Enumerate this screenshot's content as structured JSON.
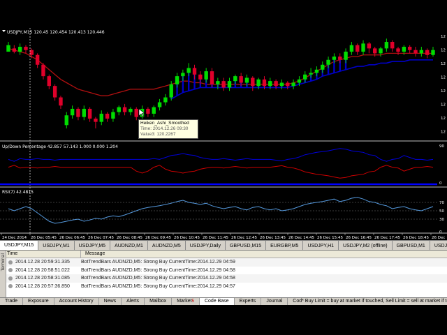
{
  "chart_window": {
    "symbol_header": "USDJPY,M15  120.45 120.454 120.413 120.446",
    "colors": {
      "bull": "#00dd00",
      "bear": "#e0002a",
      "ma_red": "#b01010",
      "ma_blue": "#0000c8",
      "up_line": "#0000dd",
      "down_line": "#cc0000",
      "rsi_line": "#5599dd",
      "grid": "#303030"
    }
  },
  "price_axis": {
    "labels": [
      "12",
      "12",
      "12",
      "12",
      "12",
      "12",
      "12",
      "12"
    ]
  },
  "updown_panel": {
    "label": "Up/Down Percentage 42.857 57.143 1.000 0.000 1.204",
    "axis_top": "90",
    "axis_bottom": "0"
  },
  "rsi_panel": {
    "label": "RSI(7) 42.4815",
    "levels": [
      "70",
      "50",
      "30",
      "0"
    ]
  },
  "time_axis": [
    "24 Dec 2014",
    "26 Dec 05:45",
    "26 Dec 06:45",
    "26 Dec 07:45",
    "26 Dec 08:45",
    "26 Dec 09:45",
    "26 Dec 10:45",
    "26 Dec 11:45",
    "26 Dec 12:45",
    "26 Dec 13:45",
    "26 Dec 14:45",
    "26 Dec 15:45",
    "26 Dec 16:45",
    "26 Dec 17:45",
    "26 Dec 18:45",
    "26 Dec"
  ],
  "tooltip": {
    "line1": "Heiken_Ashi_Smoothed",
    "line2": "Time: 2014.12.26 09:30",
    "line3": "Value3: 120.2267"
  },
  "chart_tabs": [
    "USDJPY,M15",
    "USDJPY,M1",
    "USDJPY,M5",
    "AUDNZD,M1",
    "AUDNZD,M5",
    "USDJPY,Daily",
    "GBPUSD,M15",
    "EURGBP,M5",
    "USDJPY,H1",
    "USDJPY,M2 (offline)",
    "GBPUSD,M1",
    "USDJPY,M"
  ],
  "terminal": {
    "side_label": "Terminal",
    "col_time": "Time",
    "col_message": "Message",
    "rows": [
      {
        "time": "2014.12.28 20:59:31.335",
        "message": "BotTrendBars AUDNZD,M5: Strong Buy CurrentTime:2014.12.29 04:59"
      },
      {
        "time": "2014.12.28 20:58:51.022",
        "message": "BotTrendBars AUDNZD,M5: Strong Buy CurrentTime:2014.12.29 04:58"
      },
      {
        "time": "2014.12.28 20:58:31.085",
        "message": "BotTrendBars AUDNZD,M5: Strong Buy CurrentTime:2014.12.29 04:58"
      },
      {
        "time": "2014.12.28 20:57:36.850",
        "message": "BotTrendBars AUDNZD,M5: Strong Buy CurrentTime:2014.12.29 04:57"
      }
    ]
  },
  "bottom_tabs": [
    "Trade",
    "Exposure",
    "Account History",
    "News",
    "Alerts",
    "Mailbox",
    "Market",
    "Code Base",
    "Experts",
    "Journal"
  ],
  "market_badge": "5",
  "status_hint": "Cod* Buy Limit = buy at market if touched, Sell Limit = sell at market if touched",
  "candles": [
    [
      120.43,
      120.47,
      120.45,
      120.49
    ],
    [
      120.45,
      120.43,
      120.42,
      120.47
    ],
    [
      120.43,
      120.46,
      120.41,
      120.48
    ],
    [
      120.46,
      120.44,
      120.42,
      120.47
    ],
    [
      120.44,
      120.41,
      120.39,
      120.45
    ],
    [
      120.41,
      120.35,
      120.33,
      120.42
    ],
    [
      120.35,
      120.28,
      120.26,
      120.36
    ],
    [
      120.28,
      120.22,
      120.2,
      120.29
    ],
    [
      120.22,
      120.15,
      120.13,
      120.23
    ],
    [
      120.15,
      120.1,
      120.08,
      120.16
    ],
    [
      119.98,
      120.04,
      119.96,
      120.06
    ],
    [
      120.04,
      120.08,
      120.02,
      120.1
    ],
    [
      120.08,
      120.03,
      120.01,
      120.09
    ],
    [
      120.03,
      120.08,
      120.01,
      120.1
    ],
    [
      120.08,
      120.02,
      120.0,
      120.09
    ],
    [
      120.02,
      120.0,
      119.96,
      120.03
    ],
    [
      120.0,
      120.05,
      119.98,
      120.07
    ],
    [
      120.05,
      120.02,
      120.0,
      120.06
    ],
    [
      120.02,
      120.06,
      120.0,
      120.08
    ],
    [
      120.06,
      120.09,
      120.04,
      120.1
    ],
    [
      120.09,
      120.06,
      120.04,
      120.11
    ],
    [
      120.06,
      120.08,
      120.04,
      120.09
    ],
    [
      120.08,
      120.03,
      120.01,
      120.09
    ],
    [
      120.03,
      120.08,
      120.02,
      120.1
    ],
    [
      120.08,
      120.05,
      120.03,
      120.09
    ],
    [
      120.05,
      120.09,
      120.03,
      120.1
    ],
    [
      120.09,
      120.12,
      120.07,
      120.14
    ],
    [
      120.12,
      120.15,
      120.1,
      120.17
    ],
    [
      120.15,
      120.23,
      120.13,
      120.25
    ],
    [
      120.23,
      120.28,
      120.21,
      120.3
    ],
    [
      120.28,
      120.3,
      120.25,
      120.32
    ],
    [
      120.3,
      120.33,
      120.28,
      120.36
    ],
    [
      120.33,
      120.29,
      120.26,
      120.35
    ],
    [
      120.29,
      120.26,
      120.23,
      120.31
    ],
    [
      120.26,
      120.31,
      120.24,
      120.33
    ],
    [
      120.31,
      120.23,
      120.21,
      120.33
    ],
    [
      120.23,
      120.25,
      120.2,
      120.27
    ],
    [
      120.25,
      120.21,
      120.19,
      120.27
    ],
    [
      120.21,
      120.25,
      120.19,
      120.27
    ],
    [
      120.25,
      120.28,
      120.23,
      120.29
    ],
    [
      120.28,
      120.24,
      120.22,
      120.3
    ],
    [
      120.24,
      120.27,
      120.22,
      120.29
    ],
    [
      120.27,
      120.22,
      120.19,
      120.28
    ],
    [
      120.22,
      120.26,
      120.2,
      120.27
    ],
    [
      120.26,
      120.22,
      120.2,
      120.28
    ],
    [
      120.22,
      120.25,
      120.2,
      120.27
    ],
    [
      120.25,
      120.22,
      120.2,
      120.26
    ],
    [
      120.22,
      120.24,
      120.2,
      120.26
    ],
    [
      120.24,
      120.22,
      120.2,
      120.25
    ],
    [
      120.22,
      120.24,
      120.2,
      120.26
    ],
    [
      120.24,
      120.26,
      120.22,
      120.28
    ],
    [
      120.26,
      120.29,
      120.24,
      120.31
    ],
    [
      120.29,
      120.3,
      120.27,
      120.33
    ],
    [
      120.3,
      120.32,
      120.28,
      120.34
    ],
    [
      120.32,
      120.35,
      120.3,
      120.37
    ],
    [
      120.35,
      120.38,
      120.33,
      120.4
    ],
    [
      120.38,
      120.4,
      120.36,
      120.42
    ],
    [
      120.4,
      120.38,
      120.36,
      120.42
    ],
    [
      120.38,
      120.43,
      120.36,
      120.45
    ],
    [
      120.43,
      120.47,
      120.41,
      120.49
    ],
    [
      120.47,
      120.43,
      120.41,
      120.48
    ],
    [
      120.43,
      120.48,
      120.41,
      120.5
    ],
    [
      120.48,
      120.45,
      120.42,
      120.49
    ],
    [
      120.45,
      120.42,
      120.4,
      120.46
    ],
    [
      120.42,
      120.45,
      120.4,
      120.46
    ],
    [
      120.45,
      120.49,
      120.43,
      120.51
    ],
    [
      120.49,
      120.45,
      120.43,
      120.5
    ],
    [
      120.45,
      120.43,
      120.41,
      120.46
    ],
    [
      120.43,
      120.46,
      120.41,
      120.47
    ],
    [
      120.46,
      120.44,
      120.42,
      120.47
    ],
    [
      120.44,
      120.42,
      120.4,
      120.46
    ],
    [
      120.42,
      120.44,
      120.4,
      120.46
    ],
    [
      120.44,
      120.41,
      120.39,
      120.45
    ],
    [
      120.41,
      120.44,
      120.4,
      120.46
    ]
  ],
  "ma_red": [
    120.45,
    120.44,
    120.43,
    120.42,
    120.4,
    120.38,
    120.35,
    120.32,
    120.29,
    120.26,
    120.24,
    120.22,
    120.2,
    120.19,
    120.18,
    120.17,
    120.16,
    120.16,
    120.17,
    120.18,
    120.19,
    120.2,
    120.2,
    120.2,
    120.2,
    120.2,
    120.21,
    120.22,
    120.23,
    120.24,
    120.25,
    120.25,
    120.24,
    120.24,
    120.23,
    120.23,
    120.23,
    120.23,
    120.23,
    120.23,
    120.23,
    120.23,
    120.23,
    120.23,
    120.23,
    120.23,
    120.23,
    120.23,
    120.23,
    120.24,
    120.25,
    120.27,
    120.29,
    120.31,
    120.33,
    120.35,
    120.37,
    120.38,
    120.39,
    120.4,
    120.4,
    120.41,
    120.41,
    120.41,
    120.41,
    120.42,
    120.42,
    120.42,
    120.42,
    120.42,
    120.42,
    120.42,
    120.42,
    120.42
  ],
  "ma_blue": [
    null,
    null,
    null,
    null,
    null,
    null,
    null,
    null,
    null,
    null,
    null,
    null,
    null,
    null,
    null,
    null,
    null,
    null,
    null,
    null,
    null,
    null,
    null,
    null,
    null,
    null,
    null,
    null,
    120.14,
    120.16,
    120.18,
    120.19,
    120.2,
    120.21,
    120.21,
    120.21,
    120.21,
    120.21,
    120.21,
    120.21,
    120.21,
    120.21,
    120.21,
    120.21,
    120.21,
    120.21,
    120.21,
    120.21,
    120.21,
    120.22,
    120.23,
    120.24,
    120.25,
    120.26,
    120.28,
    120.29,
    120.3,
    120.31,
    120.32,
    120.33,
    120.34,
    120.34,
    120.35,
    120.35,
    120.36,
    120.36,
    120.37,
    120.37,
    120.37,
    120.38,
    120.38,
    120.38,
    120.38,
    120.38
  ],
  "updown_up": [
    60,
    55,
    62,
    60,
    60,
    62,
    60,
    60,
    58,
    60,
    60,
    60,
    60,
    60,
    60,
    60,
    60,
    60,
    60,
    60,
    60,
    60,
    60,
    60,
    60,
    62,
    60,
    65,
    70,
    72,
    75,
    72,
    70,
    65,
    62,
    60,
    60,
    62,
    60,
    58,
    60,
    62,
    60,
    60,
    60,
    60,
    58,
    56,
    60,
    62,
    66,
    72,
    75,
    78,
    80,
    82,
    85,
    88,
    86,
    82,
    80,
    78,
    72,
    70,
    60,
    55,
    60,
    62,
    70,
    65,
    60,
    60,
    58,
    60
  ],
  "updown_down": [
    40,
    45,
    38,
    40,
    40,
    38,
    40,
    40,
    42,
    40,
    40,
    40,
    40,
    40,
    40,
    40,
    40,
    40,
    40,
    40,
    40,
    40,
    30,
    25,
    30,
    40,
    45,
    35,
    30,
    28,
    25,
    28,
    30,
    35,
    38,
    40,
    40,
    38,
    40,
    42,
    40,
    38,
    40,
    40,
    40,
    40,
    42,
    44,
    40,
    38,
    34,
    28,
    25,
    22,
    20,
    18,
    15,
    12,
    14,
    18,
    20,
    22,
    28,
    30,
    40,
    45,
    40,
    38,
    30,
    35,
    40,
    40,
    42,
    40
  ],
  "rsi": [
    55,
    50,
    55,
    60,
    55,
    45,
    35,
    25,
    20,
    22,
    25,
    28,
    30,
    25,
    28,
    32,
    30,
    35,
    38,
    36,
    40,
    45,
    50,
    55,
    58,
    60,
    62,
    65,
    68,
    72,
    75,
    70,
    68,
    65,
    68,
    62,
    58,
    55,
    58,
    60,
    55,
    52,
    58,
    60,
    55,
    52,
    55,
    50,
    52,
    55,
    60,
    65,
    68,
    70,
    72,
    75,
    78,
    72,
    75,
    80,
    82,
    78,
    72,
    70,
    65,
    62,
    55,
    58,
    60,
    55,
    52,
    50,
    55,
    60
  ]
}
